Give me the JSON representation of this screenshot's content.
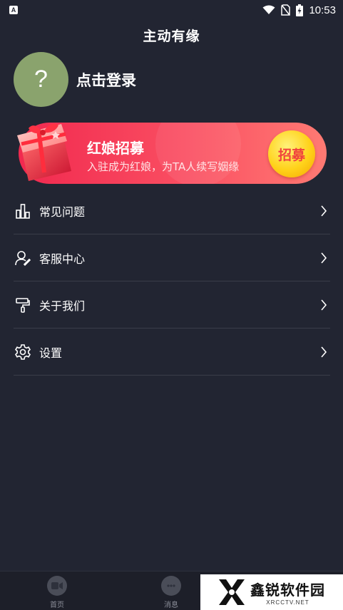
{
  "status_bar": {
    "left_icon": "A",
    "time": "10:53",
    "icons": [
      "wifi-icon",
      "no-sim-icon",
      "battery-charging-icon"
    ]
  },
  "header": {
    "title": "主动有缘"
  },
  "profile": {
    "avatar_glyph": "?",
    "login_label": "点击登录"
  },
  "banner": {
    "title": "红娘招募",
    "subtitle": "入驻成为红娘，为TA人续写姻缘",
    "button_label": "招募",
    "gradient_start": "#f1294f",
    "gradient_end": "#ff7a73"
  },
  "menu": {
    "items": [
      {
        "label": "常见问题",
        "icon": "chart-bar-icon"
      },
      {
        "label": "客服中心",
        "icon": "customer-service-icon"
      },
      {
        "label": "关于我们",
        "icon": "paint-roller-icon"
      },
      {
        "label": "设置",
        "icon": "gear-icon"
      }
    ]
  },
  "bottom_nav": {
    "items": [
      {
        "label": "首页",
        "icon": "video-icon"
      },
      {
        "label": "消息",
        "icon": "chat-bubble-icon"
      }
    ]
  },
  "watermark": {
    "name": "鑫锐软件园",
    "domain": "XRCCTV.NET"
  }
}
